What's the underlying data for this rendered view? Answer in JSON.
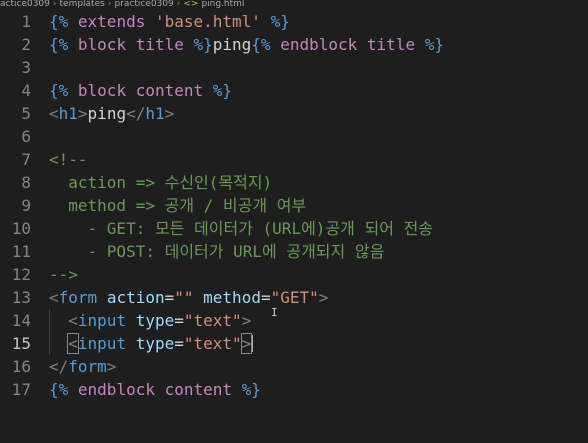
{
  "breadcrumb": {
    "parts": [
      "actice0309",
      "templates",
      "practice0309",
      "ping.html"
    ],
    "file_icon": "<>"
  },
  "editor": {
    "current_line": 15,
    "lines": [
      {
        "n": 1,
        "tokens": [
          {
            "c": "t-tmpl",
            "t": "{% "
          },
          {
            "c": "t-kw",
            "t": "extends "
          },
          {
            "c": "t-str",
            "t": "'base.html' "
          },
          {
            "c": "t-tmpl",
            "t": "%}"
          }
        ]
      },
      {
        "n": 2,
        "tokens": [
          {
            "c": "t-tmpl",
            "t": "{% "
          },
          {
            "c": "t-kw",
            "t": "block "
          },
          {
            "c": "t-kw",
            "t": "title "
          },
          {
            "c": "t-tmpl",
            "t": "%}"
          },
          {
            "c": "t-text",
            "t": "ping"
          },
          {
            "c": "t-tmpl",
            "t": "{% "
          },
          {
            "c": "t-kw",
            "t": "endblock "
          },
          {
            "c": "t-kw",
            "t": "title "
          },
          {
            "c": "t-tmpl",
            "t": "%}"
          }
        ]
      },
      {
        "n": 3,
        "tokens": []
      },
      {
        "n": 4,
        "tokens": [
          {
            "c": "t-tmpl",
            "t": "{% "
          },
          {
            "c": "t-kw",
            "t": "block "
          },
          {
            "c": "t-kw",
            "t": "content "
          },
          {
            "c": "t-tmpl",
            "t": "%}"
          }
        ]
      },
      {
        "n": 5,
        "tokens": [
          {
            "c": "t-punct",
            "t": "<"
          },
          {
            "c": "t-tag",
            "t": "h1"
          },
          {
            "c": "t-punct",
            "t": ">"
          },
          {
            "c": "t-text",
            "t": "ping"
          },
          {
            "c": "t-punct",
            "t": "</"
          },
          {
            "c": "t-tag",
            "t": "h1"
          },
          {
            "c": "t-punct",
            "t": ">"
          }
        ]
      },
      {
        "n": 6,
        "tokens": []
      },
      {
        "n": 7,
        "tokens": [
          {
            "c": "t-cmt",
            "t": "<!--"
          }
        ]
      },
      {
        "n": 8,
        "tokens": [
          {
            "c": "t-cmt",
            "t": "  action => 수신인(목적지)"
          }
        ]
      },
      {
        "n": 9,
        "tokens": [
          {
            "c": "t-cmt",
            "t": "  method => 공개 / 비공개 여부"
          }
        ]
      },
      {
        "n": 10,
        "tokens": [
          {
            "c": "t-cmt",
            "t": "    - GET: 모든 데이터가 (URL에)공개 되어 전송"
          }
        ]
      },
      {
        "n": 11,
        "tokens": [
          {
            "c": "t-cmt",
            "t": "    - POST: 데이터가 URL에 공개되지 않음"
          }
        ]
      },
      {
        "n": 12,
        "tokens": [
          {
            "c": "t-cmt",
            "t": "-->"
          }
        ]
      },
      {
        "n": 13,
        "tokens": [
          {
            "c": "t-punct",
            "t": "<"
          },
          {
            "c": "t-tag",
            "t": "form "
          },
          {
            "c": "t-attr",
            "t": "action"
          },
          {
            "c": "t-text",
            "t": "="
          },
          {
            "c": "t-str",
            "t": "\"\" "
          },
          {
            "c": "t-attr",
            "t": "method"
          },
          {
            "c": "t-text",
            "t": "="
          },
          {
            "c": "t-str",
            "t": "\"GET\""
          },
          {
            "c": "t-punct",
            "t": ">"
          }
        ]
      },
      {
        "n": 14,
        "tokens": [
          {
            "c": "t-text",
            "t": "  "
          },
          {
            "c": "t-punct",
            "t": "<"
          },
          {
            "c": "t-tag",
            "t": "input "
          },
          {
            "c": "t-attr",
            "t": "type"
          },
          {
            "c": "t-text",
            "t": "="
          },
          {
            "c": "t-str",
            "t": "\"text\""
          },
          {
            "c": "t-punct",
            "t": ">"
          }
        ]
      },
      {
        "n": 15,
        "tokens": [
          {
            "c": "t-text",
            "t": "  "
          },
          {
            "c": "t-punct bracket-box",
            "t": "<"
          },
          {
            "c": "t-tag",
            "t": "input "
          },
          {
            "c": "t-attr",
            "t": "type"
          },
          {
            "c": "t-text",
            "t": "="
          },
          {
            "c": "t-str",
            "t": "\"text\""
          },
          {
            "c": "t-punct bracket-box",
            "t": ">"
          },
          {
            "c": "cursor",
            "t": ""
          }
        ]
      },
      {
        "n": 16,
        "tokens": [
          {
            "c": "t-punct",
            "t": "</"
          },
          {
            "c": "t-tag",
            "t": "form"
          },
          {
            "c": "t-punct",
            "t": ">"
          }
        ]
      },
      {
        "n": 17,
        "tokens": [
          {
            "c": "t-tmpl",
            "t": "{% "
          },
          {
            "c": "t-kw",
            "t": "endblock "
          },
          {
            "c": "t-kw",
            "t": "content "
          },
          {
            "c": "t-tmpl",
            "t": "%}"
          }
        ]
      }
    ]
  },
  "colors": {
    "background": "#1e1e1e",
    "line_number": "#858585",
    "template_delimiter": "#569cd6",
    "keyword": "#c586c0",
    "string": "#ce9178",
    "comment": "#6a9955",
    "attribute": "#9cdcfe",
    "tag": "#569cd6"
  }
}
